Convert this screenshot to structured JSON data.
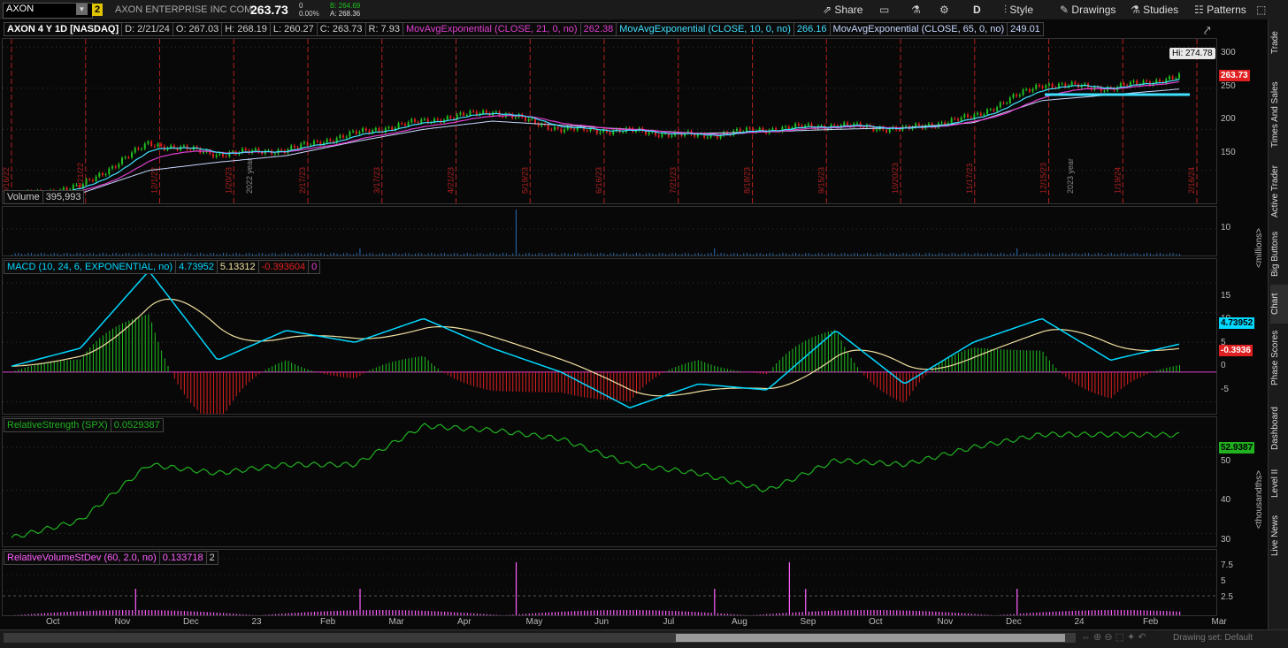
{
  "toolbar": {
    "symbol": "AXON",
    "link_badge": "2",
    "company": "AXON ENTERPRISE INC COM",
    "last": "263.73",
    "change": "0",
    "change_pct": "0.00%",
    "bid": "B: 264.69",
    "ask": "A: 268.36",
    "share": "Share",
    "period": "D",
    "style": "Style",
    "drawings": "Drawings",
    "studies": "Studies",
    "patterns": "Patterns"
  },
  "price_panel": {
    "title": "AXON 4 Y 1D [NASDAQ]",
    "date": "D: 2/21/24",
    "open": "O: 267.03",
    "high": "H: 268.19",
    "low": "L: 260.27",
    "close": "C: 263.73",
    "range": "R: 7.93",
    "ema21_label": "MovAvgExponential (CLOSE, 21, 0, no)",
    "ema21_value": "262.38",
    "ema10_label": "MovAvgExponential (CLOSE, 10, 0, no)",
    "ema10_value": "266.16",
    "ema65_label": "MovAvgExponential (CLOSE, 65, 0, no)",
    "ema65_value": "249.01",
    "hi_bubble": "Hi: 274.78",
    "price_tag": "263.73",
    "y_ticks": [
      "300",
      "250",
      "200",
      "150"
    ],
    "date_markers": [
      "9/16/22",
      "10/21/22",
      "12/1/22",
      "1/20/23",
      "2/17/23",
      "3/17/23",
      "4/21/23",
      "5/19/23",
      "6/16/23",
      "7/21/23",
      "8/18/23",
      "9/15/23",
      "10/20/23",
      "11/17/23",
      "12/15/23",
      "1/19/24",
      "2/16/24"
    ],
    "year_labels": [
      "2022 year",
      "2023 year"
    ]
  },
  "volume_panel": {
    "title": "Volume",
    "value": "395,993",
    "y_ticks": [
      "10"
    ],
    "unit": "<millions>"
  },
  "macd_panel": {
    "title": "MACD (10, 24, 6, EXPONENTIAL, no)",
    "value": "4.73952",
    "avg": "5.13312",
    "diff": "-0.393604",
    "zero": "0",
    "tag_value": "4.73952",
    "tag_diff": "-0.3936",
    "y_ticks": [
      "15",
      "10",
      "5",
      "0",
      "-5"
    ]
  },
  "rs_panel": {
    "title": "RelativeStrength (SPX)",
    "value": "0.0529387",
    "tag_value": "52.9387",
    "y_ticks": [
      "50",
      "40",
      "30"
    ],
    "unit": "<thousandths>"
  },
  "rvsd_panel": {
    "title": "RelativeVolumeStDev (60, 2.0, no)",
    "value": "0.133718",
    "threshold": "2",
    "y_ticks": [
      "7.5",
      "5",
      "2.5"
    ]
  },
  "x_axis": [
    "Oct",
    "Nov",
    "Dec",
    "23",
    "Feb",
    "Mar",
    "Apr",
    "May",
    "Jun",
    "Jul",
    "Aug",
    "Sep",
    "Oct",
    "Nov",
    "Dec",
    "24",
    "Feb",
    "Mar"
  ],
  "side_tabs": [
    "Trade",
    "Times And Sales",
    "Active Trader",
    "Big Buttons",
    "Chart",
    "Phase Scores",
    "Dashboard",
    "Level II",
    "Live News"
  ],
  "status": "Drawing set: Default",
  "colors": {
    "ema21": "#e040d0",
    "ema10": "#40e0ff",
    "ema65": "#c8d8ff",
    "up": "#20c020",
    "down": "#e02020",
    "macd": "#00d8ff",
    "avg": "#f0e0a0",
    "rs": "#20b020",
    "rvsd": "#ff60ff"
  },
  "chart_data": [
    {
      "type": "line",
      "title": "AXON 4 Y 1D [NASDAQ]",
      "x": [
        "2022-09",
        "2022-10",
        "2022-11",
        "2022-12",
        "2023-01",
        "2023-02",
        "2023-03",
        "2023-04",
        "2023-05",
        "2023-06",
        "2023-07",
        "2023-08",
        "2023-09",
        "2023-10",
        "2023-11",
        "2023-12",
        "2024-01",
        "2024-02"
      ],
      "series": [
        {
          "name": "Close",
          "values": [
            118,
            130,
            183,
            170,
            175,
            195,
            210,
            222,
            200,
            198,
            192,
            200,
            205,
            200,
            215,
            255,
            250,
            264
          ]
        },
        {
          "name": "MovAvgExponential (CLOSE, 65, 0, no)",
          "values": [
            120,
            122,
            150,
            160,
            168,
            185,
            200,
            210,
            205,
            200,
            195,
            197,
            200,
            202,
            208,
            235,
            242,
            249
          ]
        }
      ],
      "ylim": [
        110,
        310
      ]
    },
    {
      "type": "line",
      "title": "MACD (10, 24, 6, EXPONENTIAL, no)",
      "x": [
        "2022-09",
        "2022-10",
        "2022-11",
        "2022-12",
        "2023-01",
        "2023-02",
        "2023-03",
        "2023-04",
        "2023-05",
        "2023-06",
        "2023-07",
        "2023-08",
        "2023-09",
        "2023-10",
        "2023-11",
        "2023-12",
        "2024-01",
        "2024-02"
      ],
      "series": [
        {
          "name": "MACD",
          "values": [
            1,
            4,
            17,
            2,
            7,
            5,
            9,
            4,
            0,
            -6,
            -2,
            -3,
            7,
            -2,
            5,
            9,
            2,
            4.7
          ]
        }
      ],
      "ylim": [
        -7,
        19
      ]
    },
    {
      "type": "line",
      "title": "RelativeStrength (SPX)",
      "x": [
        "2022-09",
        "2022-10",
        "2022-11",
        "2022-12",
        "2023-01",
        "2023-02",
        "2023-03",
        "2023-04",
        "2023-05",
        "2023-06",
        "2023-07",
        "2023-08",
        "2023-09",
        "2023-10",
        "2023-11",
        "2023-12",
        "2024-01",
        "2024-02"
      ],
      "series": [
        {
          "name": "RelativeStrength (SPX)",
          "values": [
            29,
            33,
            46,
            44,
            46,
            46,
            55,
            54,
            52,
            46,
            44,
            40,
            47,
            46,
            50,
            53,
            53,
            52.9
          ]
        }
      ],
      "ylim": [
        27,
        57
      ]
    }
  ]
}
